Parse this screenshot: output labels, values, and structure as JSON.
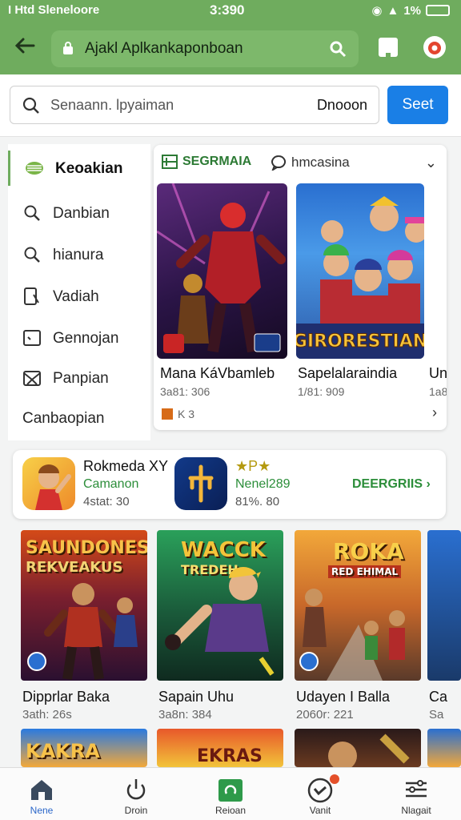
{
  "status": {
    "left": "I Htd Sleneloore",
    "time": "3:390",
    "right": "1%"
  },
  "header": {
    "title": "Ajakl Aplkankaponboan"
  },
  "search": {
    "placeholder": "Senaann. lpyaiman",
    "scope": "Dnooon",
    "button": "Seet"
  },
  "sidebar": {
    "items": [
      {
        "label": "Keoakian",
        "icon": "gamepad-icon"
      },
      {
        "label": "Danbian",
        "icon": "search-icon"
      },
      {
        "label": "hianura",
        "icon": "search-icon"
      },
      {
        "label": "Vadiah",
        "icon": "bookmark-icon"
      },
      {
        "label": "Gennojan",
        "icon": "window-icon"
      },
      {
        "label": "Panpian",
        "icon": "mail-icon"
      },
      {
        "label": "Canbaopian",
        "icon": ""
      }
    ]
  },
  "category": {
    "tab1": "SEGRMAIA",
    "tab2": "hmcasina",
    "cards": [
      {
        "title": "Mana KáVbamleb",
        "meta": "3a81: 306"
      },
      {
        "title": "Sapelalaraindia",
        "meta": "1/81: 909",
        "banner": "GIRORESTIAN"
      },
      {
        "title": "Un",
        "meta": "1a8"
      }
    ],
    "footer": "K 3"
  },
  "featured": {
    "items": [
      {
        "name": "Rokmeda XY",
        "category": "Camanon",
        "meta": "4stat: 30"
      },
      {
        "name": "★P★",
        "category": "Nenel289",
        "meta": "81%. 80"
      }
    ],
    "link": "DEERGRIIS ›"
  },
  "grid": [
    {
      "title": "Dipprlar Baka",
      "meta": "3ath: 26s",
      "poster": "SAUNDONES",
      "poster2": "REKVEAKUS"
    },
    {
      "title": "Sapain Uhu",
      "meta": "3a8n: 384",
      "poster": "WACCK",
      "poster2": "TREDEH"
    },
    {
      "title": "Udayen I Balla",
      "meta": "2060r: 221",
      "poster": "ROKA",
      "poster2": "RED EHIMAL"
    },
    {
      "title": "Ca",
      "meta": "Sa"
    }
  ],
  "grid_row2": [
    "KAKRA",
    "EKRAS",
    ""
  ],
  "nav": [
    {
      "label": "Nene",
      "icon": "home-icon"
    },
    {
      "label": "Droin",
      "icon": "power-icon"
    },
    {
      "label": "Reioan",
      "icon": "store-icon"
    },
    {
      "label": "Vanit",
      "icon": "gamepad-icon"
    },
    {
      "label": "Nlagait",
      "icon": "settings-sliders-icon"
    }
  ],
  "colors": {
    "header": "#6fac5e",
    "accent_blue": "#1a7fe6",
    "accent_green": "#2c8e3a"
  }
}
